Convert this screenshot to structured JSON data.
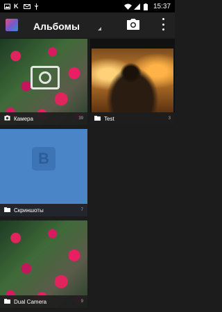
{
  "status_bar": {
    "time": "15:37",
    "left_icons": [
      "image-icon",
      "k-app-icon",
      "mail-icon",
      "usb-icon"
    ],
    "right_icons": [
      "wifi-icon",
      "signal-icon",
      "battery-icon"
    ]
  },
  "app_bar": {
    "title": "Альбомы",
    "camera_icon": "camera-icon",
    "more_icon": "more-vert-icon"
  },
  "albums": [
    {
      "name": "Камера",
      "count": "39",
      "icon": "camera-icon"
    },
    {
      "name": "Test",
      "count": "3",
      "icon": "folder-icon"
    },
    {
      "name": "Скриншоты",
      "count": "7",
      "icon": "folder-icon"
    },
    {
      "name": "Dual Camera",
      "count": "9",
      "icon": "folder-icon"
    }
  ],
  "colors": {
    "background": "#1c1c1c",
    "appbar": "#212121",
    "vk_blue": "#4a85c7"
  }
}
